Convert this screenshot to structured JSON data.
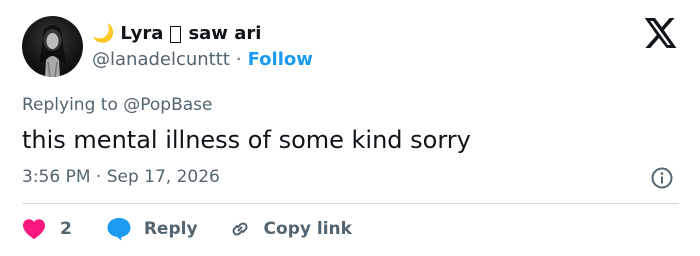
{
  "tweet": {
    "display_name": "Lyra",
    "name_suffix": "saw ari",
    "handle": "@lanadelcunttt",
    "separator": "·",
    "follow_label": "Follow",
    "replying_to_prefix": "Replying to",
    "replying_to_handle": "@PopBase",
    "text": "this mental illness of some kind sorry",
    "time": "3:56 PM",
    "date": "Sep 17, 2026"
  },
  "actions": {
    "like_count": "2",
    "reply_label": "Reply",
    "copy_link_label": "Copy link"
  },
  "icons": {
    "avatar": "avatar-photo",
    "name_emoji": "crescent-moon-icon",
    "platform_logo": "x-logo-icon",
    "info": "info-icon",
    "like": "heart-icon",
    "reply": "speech-bubble-icon",
    "copy": "link-icon"
  },
  "colors": {
    "text_primary": "#0f1419",
    "text_secondary": "#536471",
    "link_blue": "#1d9bf0",
    "like_pink": "#f91880",
    "divider": "#cfd9de"
  }
}
